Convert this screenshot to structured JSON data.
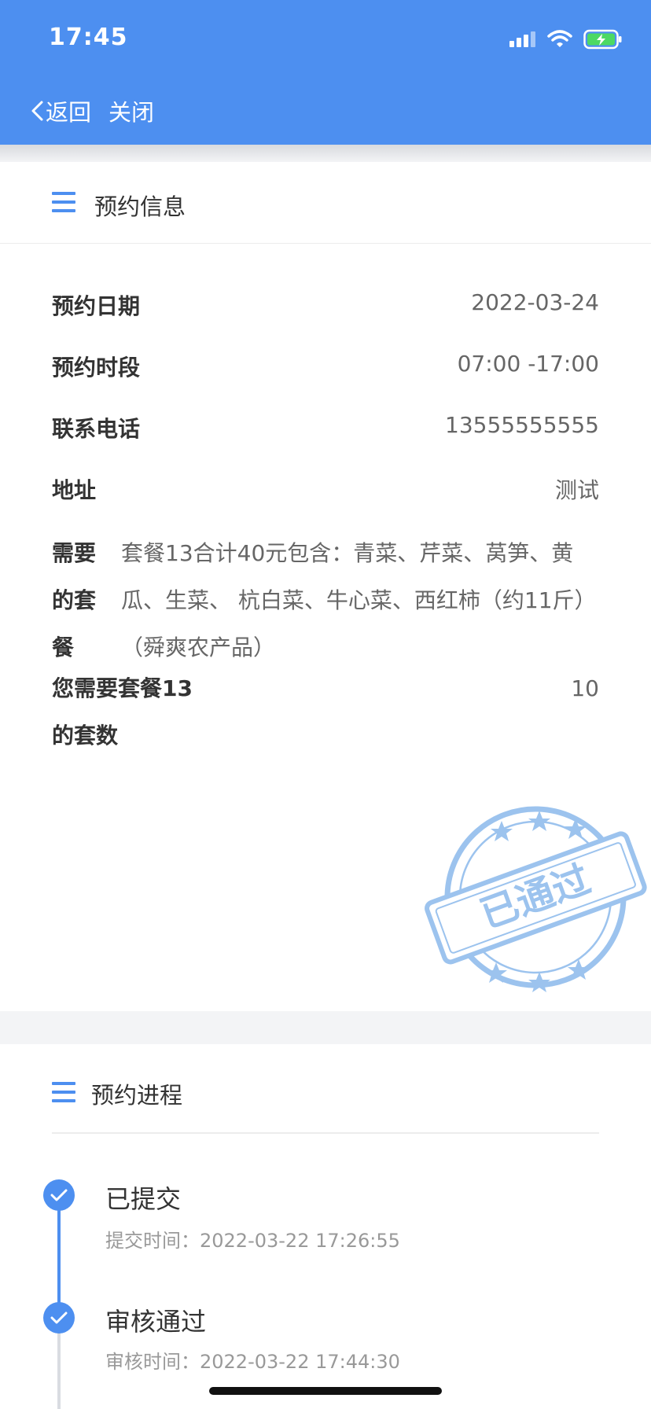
{
  "status_bar": {
    "time": "17:45"
  },
  "nav": {
    "back_label": "返回",
    "close_label": "关闭"
  },
  "colors": {
    "accent": "#4d8ff0",
    "stamp": "#9cc3ee",
    "label": "#333333",
    "value": "#666666",
    "muted": "#999999"
  },
  "booking_info": {
    "title": "预约信息",
    "rows": [
      {
        "label": "预约日期",
        "value": "2022-03-24"
      },
      {
        "label": "预约时段",
        "value": "07:00 -17:00"
      },
      {
        "label": "联系电话",
        "value": "13555555555"
      },
      {
        "label": "地址",
        "value": "测试"
      }
    ],
    "package": {
      "label": "需要的套餐",
      "value": "套餐13合计40元包含：青菜、芹菜、莴笋、黄瓜、生菜、 杭白菜、牛心菜、西红柿（约11斤）（舜爽农产品）"
    },
    "count": {
      "label": "您需要套餐13的套数",
      "value": "10"
    },
    "stamp_text": "已通过"
  },
  "progress": {
    "title": "预约进程",
    "steps": [
      {
        "title": "已提交",
        "time": "提交时间：2022-03-22 17:26:55"
      },
      {
        "title": "审核通过",
        "time": "审核时间：2022-03-22 17:44:30"
      }
    ]
  }
}
